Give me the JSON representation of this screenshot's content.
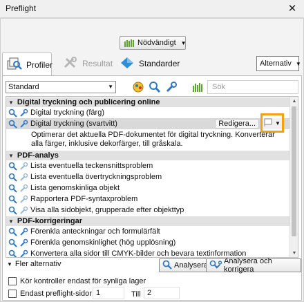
{
  "window": {
    "title": "Preflight"
  },
  "top_dropdown": {
    "label": "Nödvändigt"
  },
  "tabs": [
    {
      "label": "Profiler"
    },
    {
      "label": "Resultat"
    },
    {
      "label": "Standarder"
    }
  ],
  "options_button": {
    "label": "Alternativ"
  },
  "toolbar": {
    "profile_select": "Standard",
    "search_placeholder": "Sök"
  },
  "groups": [
    {
      "title": "Digital tryckning och publicering online",
      "items": [
        {
          "label": "Digital tryckning (färg)"
        },
        {
          "label": "Digital tryckning (svartvitt)",
          "selected": true,
          "edit_label": "Redigera...",
          "description": "Optimerar det aktuella PDF-dokumentet för digital tryckning. Konverterar alla färger, inklusive dekorfärger, till gråskala."
        }
      ]
    },
    {
      "title": "PDF-analys",
      "items": [
        {
          "label": "Lista eventuella teckensnittsproblem"
        },
        {
          "label": "Lista eventuella övertryckningsproblem"
        },
        {
          "label": "Lista genomskinliga objekt"
        },
        {
          "label": "Rapportera PDF-syntaxproblem"
        },
        {
          "label": "Visa alla sidobjekt, grupperade efter objekttyp"
        }
      ]
    },
    {
      "title": "PDF-korrigeringar",
      "items": [
        {
          "label": "Förenkla anteckningar och formulärfält"
        },
        {
          "label": "Förenkla genomskinlighet (hög upplösning)"
        },
        {
          "label": "Konvertera alla sidor till CMYK-bilder och bevara textinformation"
        }
      ]
    }
  ],
  "footer": {
    "more_options": "Fler alternativ",
    "analyze_button": "Analysera",
    "analyze_fix_button": "Analysera och korrigera",
    "visible_layers_label": "Kör kontroller endast för synliga lager",
    "pages_label": "Endast preflight-sidor",
    "from_value": "1",
    "to_label": "Till",
    "to_value": "2"
  },
  "colors": {
    "highlight": "#f3a10e",
    "accent_green": "#5aa52a",
    "wrench_blue": "#2e78c7"
  }
}
